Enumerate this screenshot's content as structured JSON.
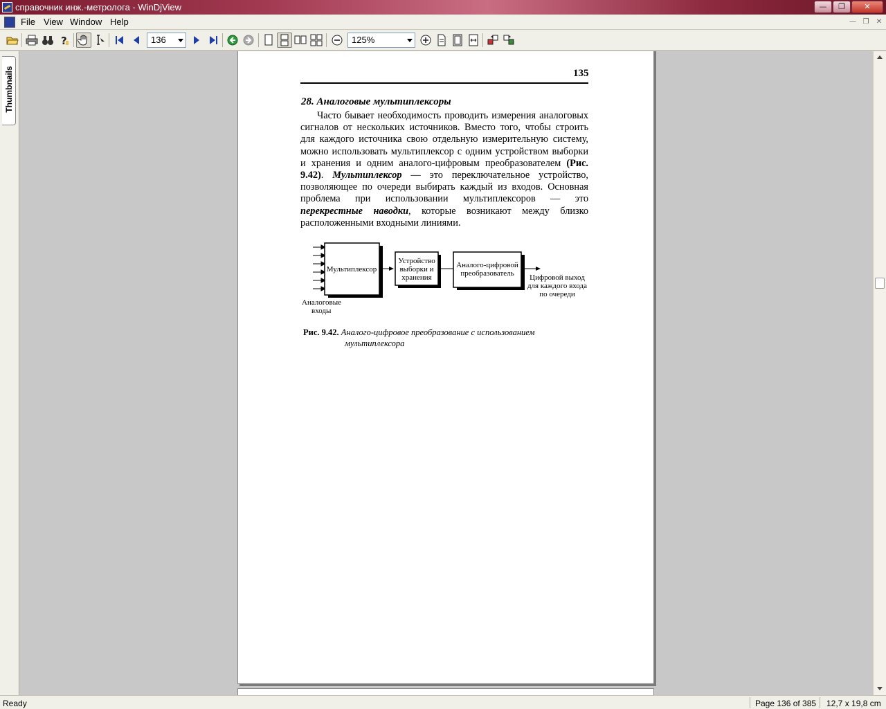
{
  "window": {
    "title": "справочник инж.-метролога - WinDjView",
    "minimize_label": "—",
    "restore_label": "❐",
    "close_label": "✕"
  },
  "menu": {
    "items": [
      {
        "label": "File"
      },
      {
        "label": "View"
      },
      {
        "label": "Window"
      },
      {
        "label": "Help"
      }
    ]
  },
  "toolbar": {
    "page_value": "136",
    "zoom_value": "125%"
  },
  "sidebar": {
    "tab_label": "Thumbnails"
  },
  "document": {
    "page_number": "135",
    "section_heading": "28. Аналоговые мультиплексоры",
    "paragraph": {
      "t1": "Часто бывает необходимость проводить измерения аналоговых сигналов от нескольких источников. Вместо того, чтобы строить для каждого источника свою отдельную измерительную систему, можно использовать мультиплексор с одним устройством выборки и хранения и одним аналого-цифровым преобразователем ",
      "ref": "(Рис. 9.42)",
      "t2": ". ",
      "term1": "Мультиплексор",
      "t3": " — это переключательное устройство, позволяющее по очереди выбирать каждый из входов. Основная проблема при использовании мультиплексоров — это ",
      "term2": "перекрестные наводки",
      "t4": ", которые возникают между близко расположенными входными линиями."
    },
    "figure": {
      "block1": "Мультиплексор",
      "block2_l1": "Устройство",
      "block2_l2": "выборки и",
      "block2_l3": "хранения",
      "block3_l1": "Аналого-цифровой",
      "block3_l2": "преобразователь",
      "inputs_l1": "Аналоговые",
      "inputs_l2": "входы",
      "output_l1": "Цифровой выход",
      "output_l2": "для каждого входа",
      "output_l3": "по очереди"
    },
    "caption": {
      "label": "Рис. 9.42.",
      "text_l1": "Аналого-цифровое преобразование с использованием",
      "text_l2": "мультиплексора"
    }
  },
  "status": {
    "ready": "Ready",
    "page_info": "Page 136 of 385",
    "page_size": "12,7 x 19,8 cm"
  }
}
